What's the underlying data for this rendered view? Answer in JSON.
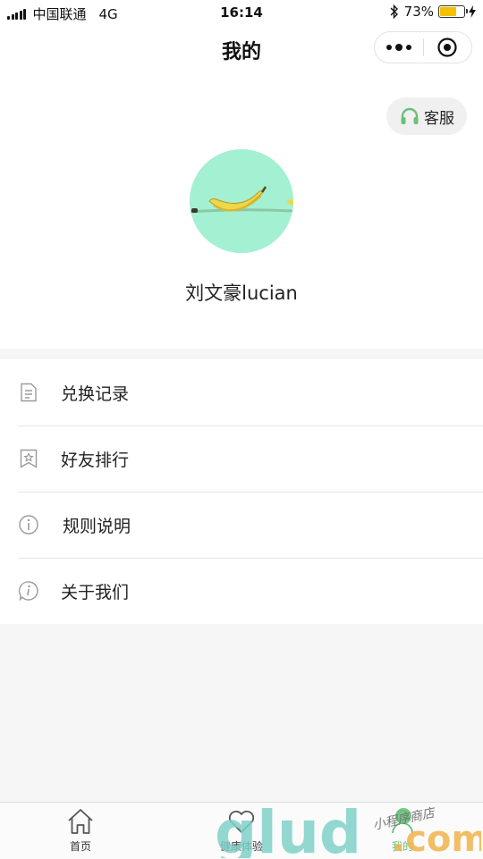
{
  "status_bar": {
    "carrier": "中国联通",
    "network": "4G",
    "time": "16:14",
    "battery": "73%",
    "battery_level": 0.73
  },
  "nav": {
    "title": "我的"
  },
  "profile": {
    "service_label": "客服",
    "username": "刘文豪lucian"
  },
  "menu": {
    "items": [
      {
        "label": "兑换记录",
        "icon": "document-icon"
      },
      {
        "label": "好友排行",
        "icon": "bookmark-star-icon"
      },
      {
        "label": "规则说明",
        "icon": "info-circle-icon"
      },
      {
        "label": "关于我们",
        "icon": "info-chat-icon"
      }
    ]
  },
  "tabbar": {
    "items": [
      {
        "label": "首页",
        "icon": "home-icon"
      },
      {
        "label": "健康体验",
        "icon": "heart-icon"
      },
      {
        "label": "我的",
        "icon": "user-icon",
        "active": true
      }
    ]
  },
  "watermark": {
    "brand": "glud.com",
    "tagline": "小程序商店"
  },
  "colors": {
    "accent": "#6abf7a",
    "avatar_bg": "#a3f0d2",
    "battery": "#f2c200"
  }
}
